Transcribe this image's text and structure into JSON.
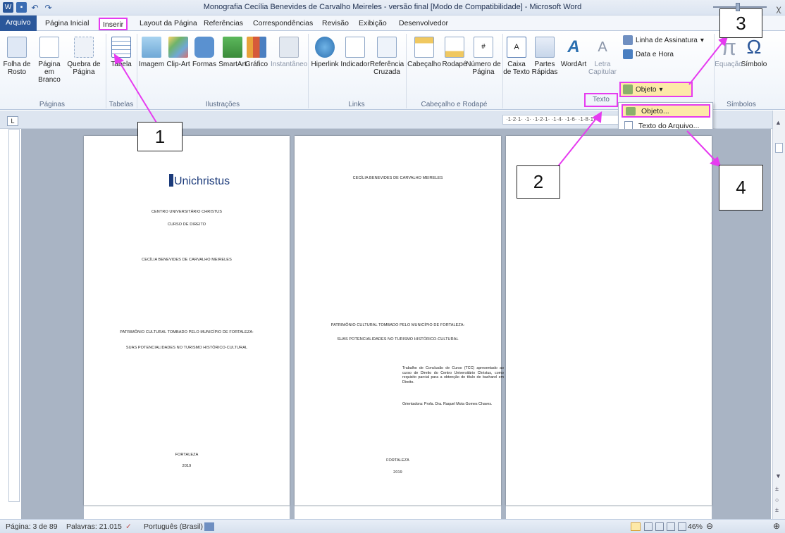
{
  "window": {
    "title": "Monografia Cecília Benevides de Carvalho Meireles - versão final [Modo de Compatibilidade] - Microsoft Word",
    "quick_access": [
      "word-icon",
      "save-icon",
      "undo-icon",
      "redo-icon"
    ],
    "close_glyph": "ꭓ"
  },
  "tabs": [
    "Arquivo",
    "Página Inicial",
    "Inserir",
    "Layout da Página",
    "Referências",
    "Correspondências",
    "Revisão",
    "Exibição",
    "Desenvolvedor"
  ],
  "ribbon": {
    "paginas": {
      "b1": "Folha de Rosto",
      "b2": "Página em Branco",
      "b3": "Quebra de Página",
      "label": "Páginas"
    },
    "tabelas": {
      "b1": "Tabela",
      "label": "Tabelas"
    },
    "ilustracoes": {
      "b1": "Imagem",
      "b2": "Clip-Art",
      "b3": "Formas",
      "b4": "SmartArt",
      "b5": "Gráfico",
      "b6": "Instantâneo",
      "label": "Ilustrações"
    },
    "links": {
      "b1": "Hiperlink",
      "b2": "Indicador",
      "b3": "Referência Cruzada",
      "label": "Links"
    },
    "cabecalho": {
      "b1": "Cabeçalho",
      "b2": "Rodapé",
      "b3": "Número de Página",
      "label": "Cabeçalho e Rodapé"
    },
    "texto": {
      "b1": "Caixa de Texto",
      "b2": "Partes Rápidas",
      "b3": "WordArt",
      "b4": "Letra Capitular",
      "s1": "Linha de Assinatura",
      "s2": "Data e Hora",
      "s3": "Objeto",
      "label": "Texto"
    },
    "simbolos": {
      "b1": "Equação",
      "b2": "Símbolo",
      "label": "Símbolos",
      "pi": "π",
      "omega": "Ω"
    }
  },
  "dropdown": {
    "item1": "Objeto...",
    "item2": "Texto do Arquivo..."
  },
  "ruler": {
    "corner": "L",
    "strip": "·1·2·1·  ·1·  ·1·2·1·  ·1·4·  ·1·6·  ·1·8·1·"
  },
  "pages": {
    "p1": {
      "logo": "Unichristus",
      "inst": "CENTRO UNIVERSITÁRIO CHRISTUS",
      "course": "CURSO DE DIREITO",
      "author": "CECÍLIA BENEVIDES DE CARVALHO MEIRELES",
      "title": "PATRIMÔNIO CULTURAL TOMBADO PELO MUNICÍPIO DE FORTALEZA:",
      "subtitle": "SUAS POTENCIALIDADES NO TURISMO HISTÓRICO-CULTURAL",
      "city": "FORTALEZA",
      "year": "2019"
    },
    "p2": {
      "author": "CECÍLIA BENEVIDES DE CARVALHO MEIRELES",
      "title": "PATRIMÔNIO CULTURAL TOMBADO PELO MUNICÍPIO DE FORTALEZA:",
      "subtitle": "SUAS POTENCIALIDADES NO TURISMO HISTÓRICO-CULTURAL",
      "note": "Trabalho de Conclusão de Curso (TCC) apresentado ao curso de Direito do Centro Universitário Christus, como requisito parcial para a obtenção do título de bacharel em Direito.",
      "advisor": "Orientadora: Profa. Dra. Raquel Mota Gomes Chaves.",
      "city": "FORTALEZA",
      "year": "2019"
    }
  },
  "callouts": [
    "1",
    "2",
    "3",
    "4"
  ],
  "statusbar": {
    "page": "Página: 3 de 89",
    "words": "Palavras: 21.015",
    "lang": "Português (Brasil)",
    "zoom": "46%",
    "zoom_level": 0.46
  },
  "colors": {
    "accent": "#2b579a",
    "highlight": "#e63bf0",
    "workspace": "#a9b4c4"
  }
}
